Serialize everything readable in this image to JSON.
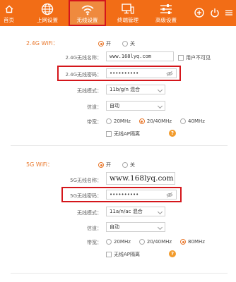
{
  "nav": {
    "home": "首页",
    "internet": "上网设置",
    "wireless": "无线设置",
    "terminal": "终端管理",
    "advanced": "高级设置"
  },
  "wifi24": {
    "title": "2.4G WiFi：",
    "on_label": "开",
    "off_label": "关",
    "ssid_label": "2.4G无线名称：",
    "ssid_value": "www.168lyq.com",
    "hide_label": "用户不可见",
    "password_label": "2.4G无线密码：",
    "password_value": "••••••••••",
    "mode_label": "无线模式：",
    "mode_value": "11b/g/n 混合",
    "channel_label": "信道：",
    "channel_value": "自动",
    "bandwidth_label": "带宽：",
    "bw_options": [
      "20MHz",
      "20/40MHz",
      "40MHz"
    ],
    "bw_selected": "20/40MHz",
    "ap_isolation_label": "无线AP隔离",
    "help_icon": "?"
  },
  "wifi5": {
    "title": "5G WiFi：",
    "on_label": "开",
    "off_label": "关",
    "ssid_label": "5G无线名称：",
    "ssid_value": "www.168lyq.com",
    "password_label": "5G无线密码：",
    "password_value": "••••••••••",
    "mode_label": "无线模式：",
    "mode_value": "11a/n/ac 混合",
    "channel_label": "信道：",
    "channel_value": "自动",
    "bandwidth_label": "带宽：",
    "bw_options": [
      "20MHz",
      "20/40MHz",
      "80MHz"
    ],
    "bw_selected": "80MHz",
    "ap_isolation_label": "无线AP隔离",
    "help_icon": "?"
  },
  "colors": {
    "brand_orange": "#f26d16",
    "accent_orange": "#e9782c",
    "highlight_red": "#d4161b"
  },
  "icons": [
    "globe-icon",
    "wifi-icon",
    "monitor-icon",
    "sliders-icon",
    "add-circle-icon",
    "power-icon",
    "eye-off-icon"
  ]
}
